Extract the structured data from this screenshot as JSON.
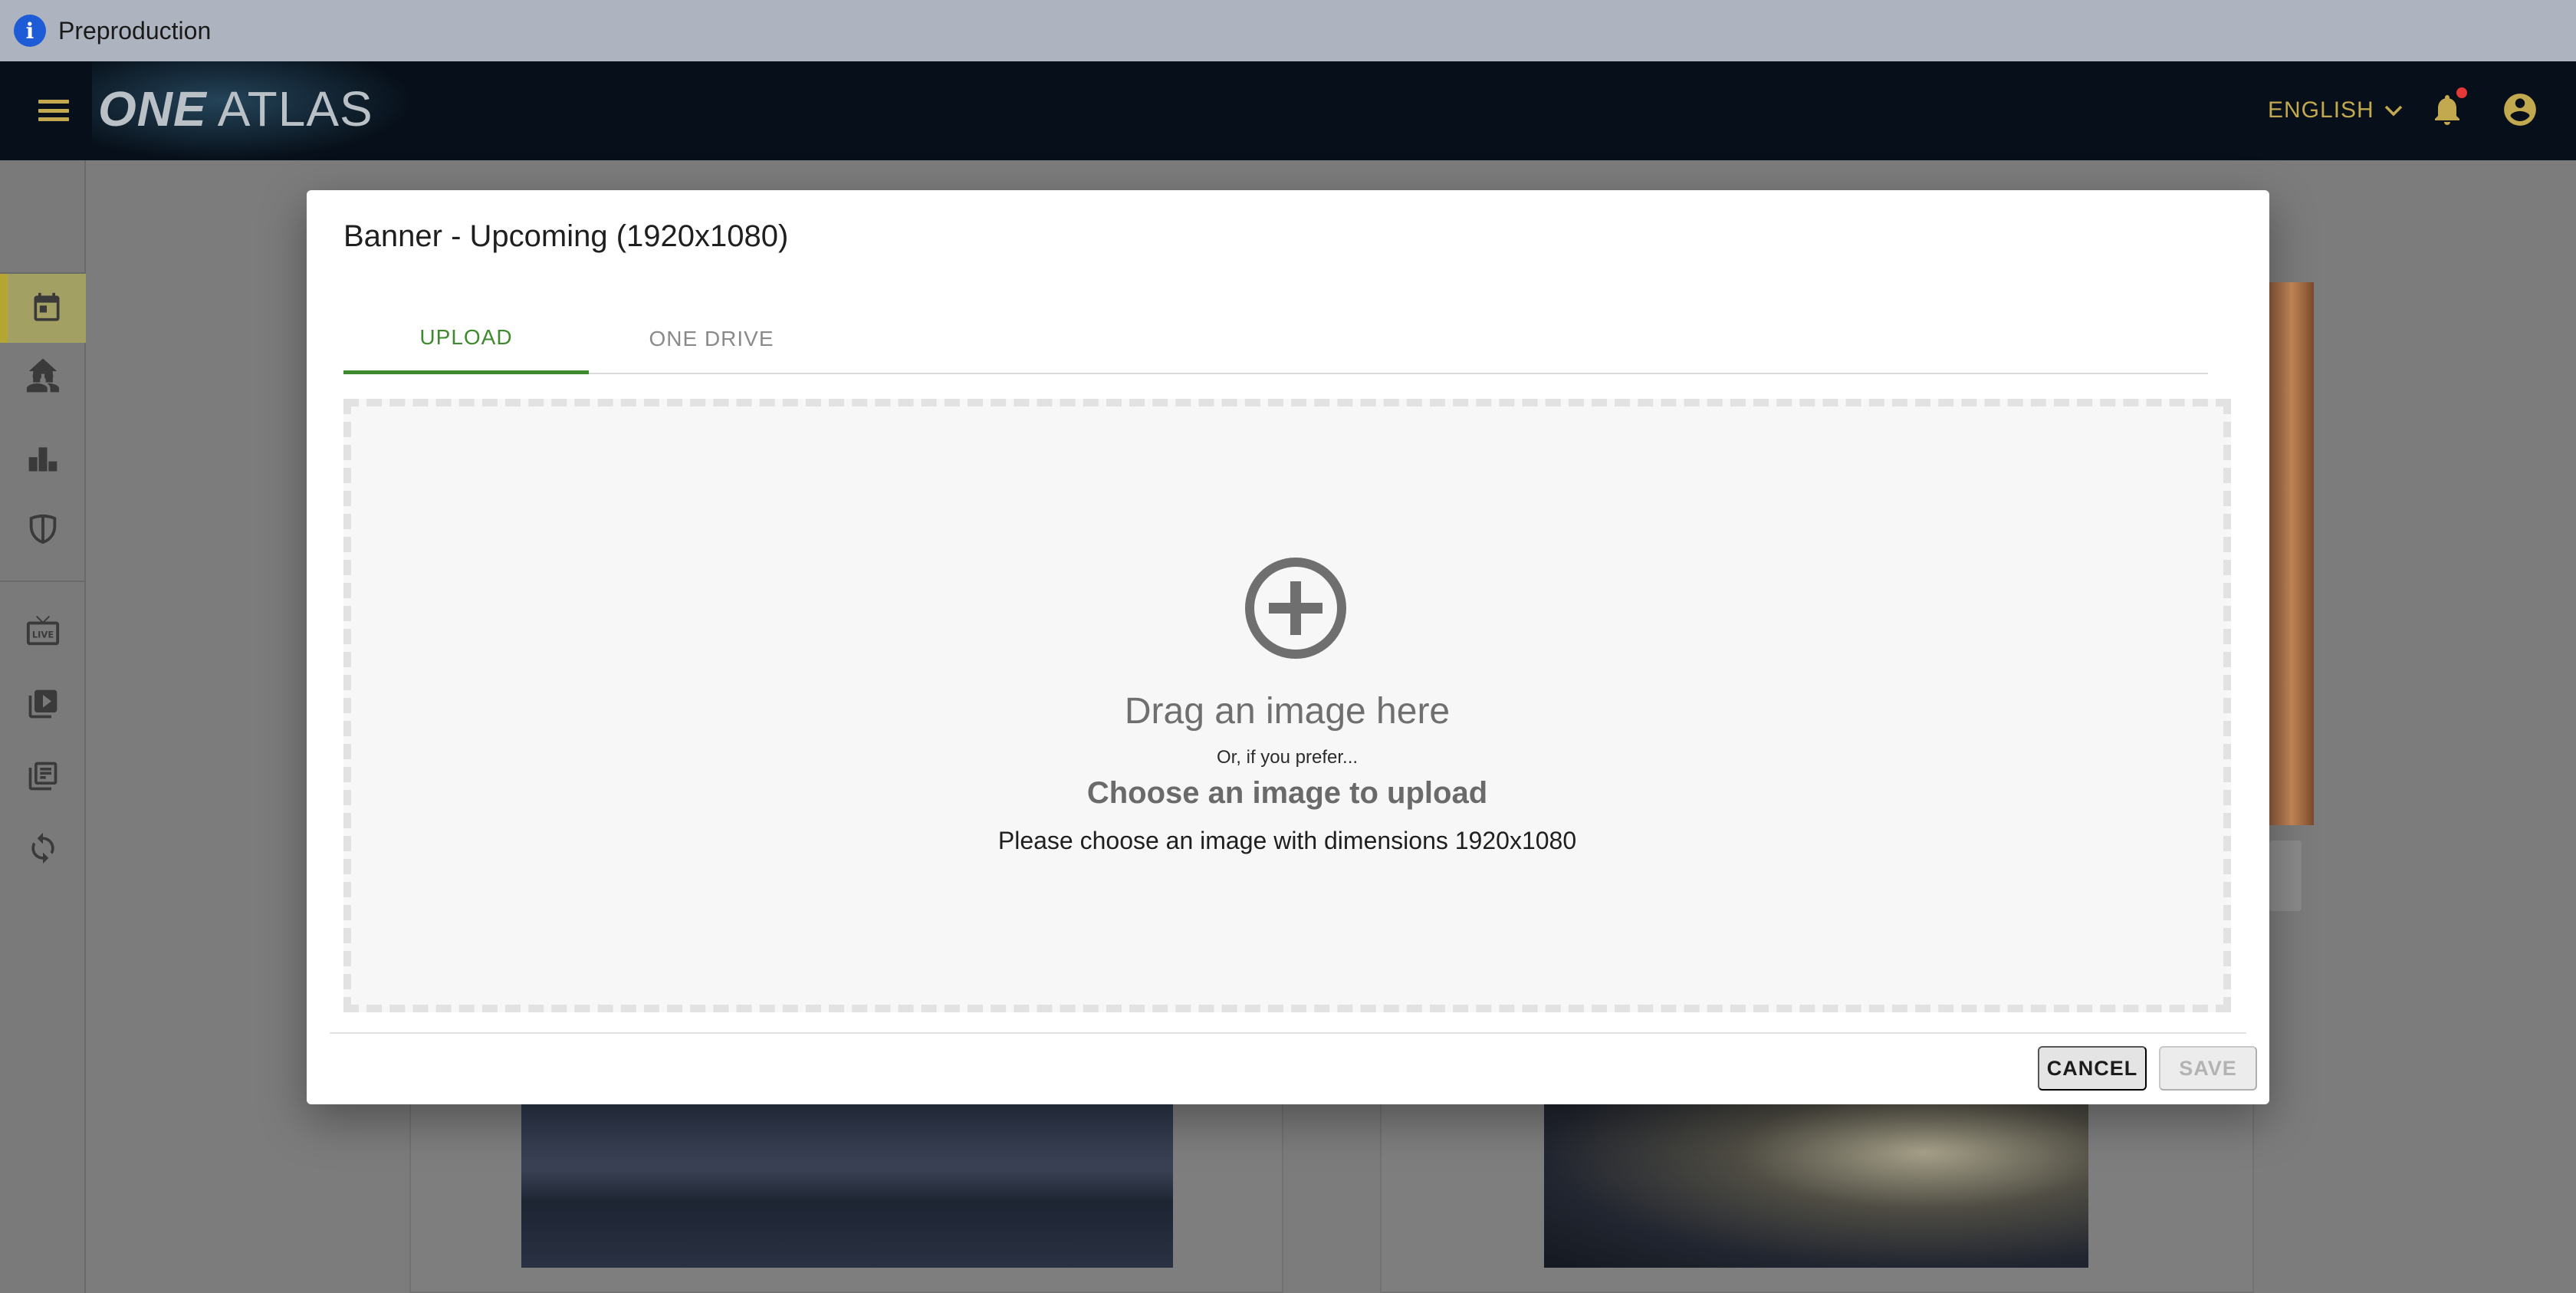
{
  "env_banner": {
    "label": "Preproduction",
    "icon": "info-icon"
  },
  "appbar": {
    "logo_bold": "ONE",
    "logo_light": "ATLAS",
    "language": "ENGLISH",
    "icons": [
      "menu-icon",
      "chevron-down-icon",
      "bell-icon",
      "account-circle-icon"
    ]
  },
  "sidenav": {
    "items": [
      {
        "icon": "home-icon",
        "active": false
      },
      {
        "icon": "calendar-icon",
        "active": true
      },
      {
        "icon": "people-icon",
        "active": false
      },
      {
        "icon": "podium-icon",
        "active": false
      },
      {
        "icon": "shield-icon",
        "active": false
      },
      {
        "icon": "live-tv-icon",
        "active": false
      },
      {
        "icon": "video-library-icon",
        "active": false
      },
      {
        "icon": "collections-icon",
        "active": false
      },
      {
        "icon": "sync-icon",
        "active": false
      }
    ]
  },
  "dialog": {
    "title": "Banner - Upcoming (1920x1080)",
    "tabs": [
      {
        "label": "UPLOAD",
        "active": true
      },
      {
        "label": "ONE DRIVE",
        "active": false
      }
    ],
    "dropzone": {
      "icon": "add-circle-icon",
      "drag_text": "Drag an image here",
      "or_text": "Or, if you prefer...",
      "choose_text": "Choose an image to upload",
      "dimensions_text": "Please choose an image with dimensions 1920x1080"
    },
    "cancel_label": "CANCEL",
    "save_label": "SAVE"
  },
  "colors": {
    "accent_green": "#3f8a2e",
    "brand_gold": "#c2a84f",
    "appbar_bg": "#07101a",
    "notification_dot": "#e53935"
  }
}
